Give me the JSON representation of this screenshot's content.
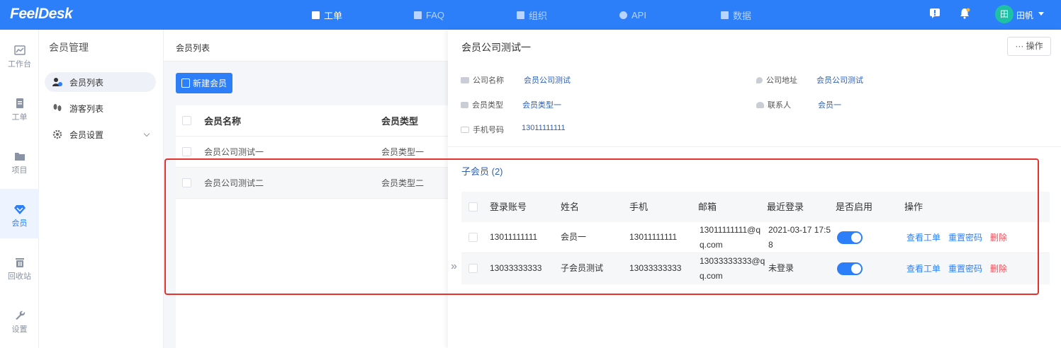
{
  "app": {
    "logo": "FeelDesk"
  },
  "topnav": [
    {
      "label": "工单",
      "active": true
    },
    {
      "label": "FAQ",
      "active": false
    },
    {
      "label": "组织",
      "active": false
    },
    {
      "label": "API",
      "active": false
    },
    {
      "label": "数据",
      "active": false
    }
  ],
  "user": {
    "avatar_text": "田",
    "name": "田帆"
  },
  "leftbar": [
    {
      "label": "工作台",
      "icon": "chart-icon"
    },
    {
      "label": "工单",
      "icon": "document-icon"
    },
    {
      "label": "项目",
      "icon": "folder-icon"
    },
    {
      "label": "会员",
      "icon": "diamond-icon",
      "active": true
    },
    {
      "label": "回收站",
      "icon": "trash-icon"
    },
    {
      "label": "设置",
      "icon": "wrench-icon"
    }
  ],
  "subnav": {
    "title": "会员管理",
    "items": [
      {
        "label": "会员列表",
        "active": true
      },
      {
        "label": "游客列表"
      },
      {
        "label": "会员设置"
      }
    ]
  },
  "list": {
    "breadcrumb": "会员列表",
    "new_button": "新建会员",
    "headers": [
      "会员名称",
      "会员类型"
    ],
    "rows": [
      [
        "会员公司测试一",
        "会员类型一"
      ],
      [
        "会员公司测试二",
        "会员类型二"
      ]
    ]
  },
  "drawer": {
    "title": "会员公司测试一",
    "op_button": "··· 操作",
    "info": {
      "company_name_label": "公司名称",
      "company_name": "会员公司测试",
      "address_label": "公司地址",
      "address": "会员公司测试",
      "type_label": "会员类型",
      "type": "会员类型一",
      "contact_label": "联系人",
      "contact": "会员一",
      "phone_label": "手机号码",
      "phone": "13011111111"
    },
    "sub_title": "子会员 (2)",
    "sub_headers": [
      "登录账号",
      "姓名",
      "手机",
      "邮箱",
      "最近登录",
      "是否启用",
      "操作"
    ],
    "sub_rows": [
      {
        "account": "13011111111",
        "name": "会员一",
        "phone": "13011111111",
        "email_1": "13011111111@q",
        "email_2": "q.com",
        "last_login_1": "2021-03-17 17:5",
        "last_login_2": "8",
        "enabled": true
      },
      {
        "account": "13033333333",
        "name": "子会员测试",
        "phone": "13033333333",
        "email_1": "13033333333@q",
        "email_2": "q.com",
        "last_login_1": "未登录",
        "last_login_2": "",
        "enabled": true
      }
    ],
    "actions": {
      "view": "查看工单",
      "reset": "重置密码",
      "delete": "删除"
    }
  },
  "colors": {
    "brand": "#2d7ff9",
    "danger": "#e8505b",
    "highlight_box": "#e5322d"
  }
}
